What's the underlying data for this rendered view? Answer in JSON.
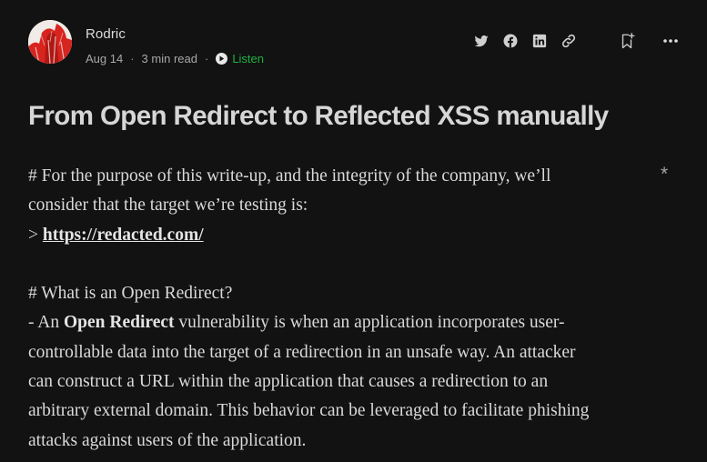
{
  "author": {
    "name": "Rodric",
    "date": "Aug 14",
    "read_time": "3 min read",
    "listen_label": "Listen"
  },
  "actions": {
    "icons": [
      "twitter-icon",
      "facebook-icon",
      "linkedin-icon",
      "link-icon",
      "bookmark-add-icon",
      "more-icon"
    ]
  },
  "article": {
    "title": "From Open Redirect to Reflected XSS manually",
    "p1_line1": "# For the purpose of this write-up, and the integrity of the company, we’ll",
    "p1_line2": "consider that the target we’re testing is:",
    "p1_line3_prefix": "> ",
    "p1_link": "https://redacted.com/",
    "p2_heading": "# What is an Open Redirect?",
    "p2_line1_prefix": "- An ",
    "p2_bold": "Open Redirect",
    "p2_line1_suffix": " vulnerability is when an application incorporates user-",
    "p2_line2": "controllable data into the target of a redirection in an unsafe way. An attacker",
    "p2_line3": "can construct a URL within the application that causes a redirection to an",
    "p2_line4": "arbitrary external domain. This behavior can be leveraged to facilitate phishing",
    "p2_line5": "attacks against users of the application."
  },
  "side_mark": "*",
  "colors": {
    "background": "#121212",
    "listen": "#1fb23f",
    "text": "#dadada"
  }
}
